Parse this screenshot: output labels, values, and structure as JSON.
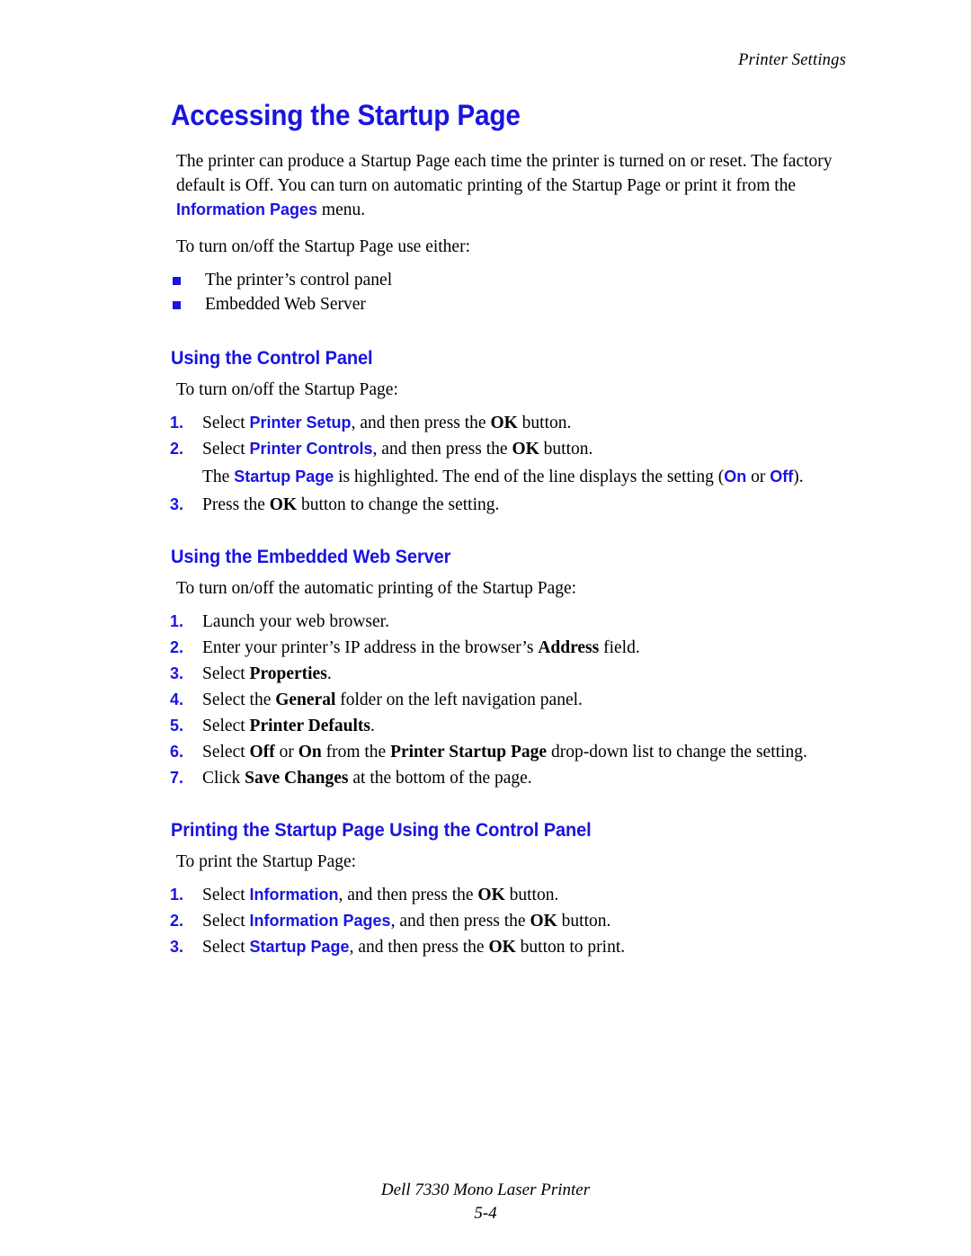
{
  "header": {
    "running_head": "Printer Settings"
  },
  "colors": {
    "accent_blue": "#1a14e0",
    "text_black": "#000000",
    "page_background": "#ffffff"
  },
  "title": "Accessing the Startup Page",
  "intro": {
    "paragraph_1_a": "The printer can produce a Startup Page each time the printer is turned on or reset. The factory default is Off. You can turn on automatic printing of the Startup Page or print it from the ",
    "paragraph_1_term": "Information Pages",
    "paragraph_1_b": " menu.",
    "paragraph_2": "To turn on/off the Startup Page use either:",
    "bullets": [
      "The printer’s control panel",
      "Embedded Web Server"
    ]
  },
  "section_control_panel": {
    "heading": "Using the Control Panel",
    "lead": "To turn on/off the Startup Page:",
    "steps": [
      {
        "num": "1.",
        "parts": [
          {
            "t": "Select ",
            "s": "plain"
          },
          {
            "t": "Printer Setup",
            "s": "ui"
          },
          {
            "t": ", and then press the ",
            "s": "plain"
          },
          {
            "t": "OK",
            "s": "bold"
          },
          {
            "t": " button.",
            "s": "plain"
          }
        ]
      },
      {
        "num": "2.",
        "parts": [
          {
            "t": "Select ",
            "s": "plain"
          },
          {
            "t": "Printer Controls",
            "s": "ui"
          },
          {
            "t": ", and then press the ",
            "s": "plain"
          },
          {
            "t": "OK",
            "s": "bold"
          },
          {
            "t": " button.",
            "s": "plain"
          }
        ]
      },
      {
        "num": "3.",
        "parts": [
          {
            "t": "Press the ",
            "s": "plain"
          },
          {
            "t": "OK",
            "s": "bold"
          },
          {
            "t": " button to change the setting.",
            "s": "plain"
          }
        ]
      }
    ],
    "substep_after_step_2": [
      {
        "t": "The ",
        "s": "plain"
      },
      {
        "t": "Startup Page",
        "s": "ui"
      },
      {
        "t": " is highlighted. The end of the line displays the setting (",
        "s": "plain"
      },
      {
        "t": "On",
        "s": "ui"
      },
      {
        "t": " or ",
        "s": "plain"
      },
      {
        "t": "Off",
        "s": "ui"
      },
      {
        "t": ").",
        "s": "plain"
      }
    ]
  },
  "section_web_server": {
    "heading": "Using the Embedded Web Server",
    "lead": "To turn on/off the automatic printing of the Startup Page:",
    "steps": [
      {
        "num": "1.",
        "parts": [
          {
            "t": "Launch your web browser.",
            "s": "plain"
          }
        ]
      },
      {
        "num": "2.",
        "parts": [
          {
            "t": "Enter your printer’s IP address in the browser’s ",
            "s": "plain"
          },
          {
            "t": "Address",
            "s": "bold"
          },
          {
            "t": " field.",
            "s": "plain"
          }
        ]
      },
      {
        "num": "3.",
        "parts": [
          {
            "t": "Select ",
            "s": "plain"
          },
          {
            "t": "Properties",
            "s": "bold"
          },
          {
            "t": ".",
            "s": "plain"
          }
        ]
      },
      {
        "num": "4.",
        "parts": [
          {
            "t": "Select the ",
            "s": "plain"
          },
          {
            "t": "General",
            "s": "bold"
          },
          {
            "t": " folder on the left navigation panel.",
            "s": "plain"
          }
        ]
      },
      {
        "num": "5.",
        "parts": [
          {
            "t": "Select ",
            "s": "plain"
          },
          {
            "t": "Printer Defaults",
            "s": "bold"
          },
          {
            "t": ".",
            "s": "plain"
          }
        ]
      },
      {
        "num": "6.",
        "parts": [
          {
            "t": "Select ",
            "s": "plain"
          },
          {
            "t": "Off",
            "s": "bold"
          },
          {
            "t": " or ",
            "s": "plain"
          },
          {
            "t": "On",
            "s": "bold"
          },
          {
            "t": " from the ",
            "s": "plain"
          },
          {
            "t": "Printer Startup Page",
            "s": "bold"
          },
          {
            "t": " drop-down list to change the setting.",
            "s": "plain"
          }
        ]
      },
      {
        "num": "7.",
        "parts": [
          {
            "t": "Click ",
            "s": "plain"
          },
          {
            "t": "Save Changes",
            "s": "bold"
          },
          {
            "t": " at the bottom of the page.",
            "s": "plain"
          }
        ]
      }
    ]
  },
  "section_printing": {
    "heading": "Printing the Startup Page Using the Control Panel",
    "lead": "To print the Startup Page:",
    "steps": [
      {
        "num": "1.",
        "parts": [
          {
            "t": "Select ",
            "s": "plain"
          },
          {
            "t": "Information",
            "s": "ui"
          },
          {
            "t": ", and then press the ",
            "s": "plain"
          },
          {
            "t": "OK",
            "s": "bold"
          },
          {
            "t": " button.",
            "s": "plain"
          }
        ]
      },
      {
        "num": "2.",
        "parts": [
          {
            "t": "Select ",
            "s": "plain"
          },
          {
            "t": "Information Pages",
            "s": "ui"
          },
          {
            "t": ", and then press the ",
            "s": "plain"
          },
          {
            "t": "OK",
            "s": "bold"
          },
          {
            "t": " button.",
            "s": "plain"
          }
        ]
      },
      {
        "num": "3.",
        "parts": [
          {
            "t": "Select ",
            "s": "plain"
          },
          {
            "t": "Startup Page",
            "s": "ui"
          },
          {
            "t": ", and then press the ",
            "s": "plain"
          },
          {
            "t": "OK",
            "s": "bold"
          },
          {
            "t": " button to print.",
            "s": "plain"
          }
        ]
      }
    ]
  },
  "footer": {
    "product": "Dell 7330 Mono Laser Printer",
    "page_number": "5-4"
  }
}
